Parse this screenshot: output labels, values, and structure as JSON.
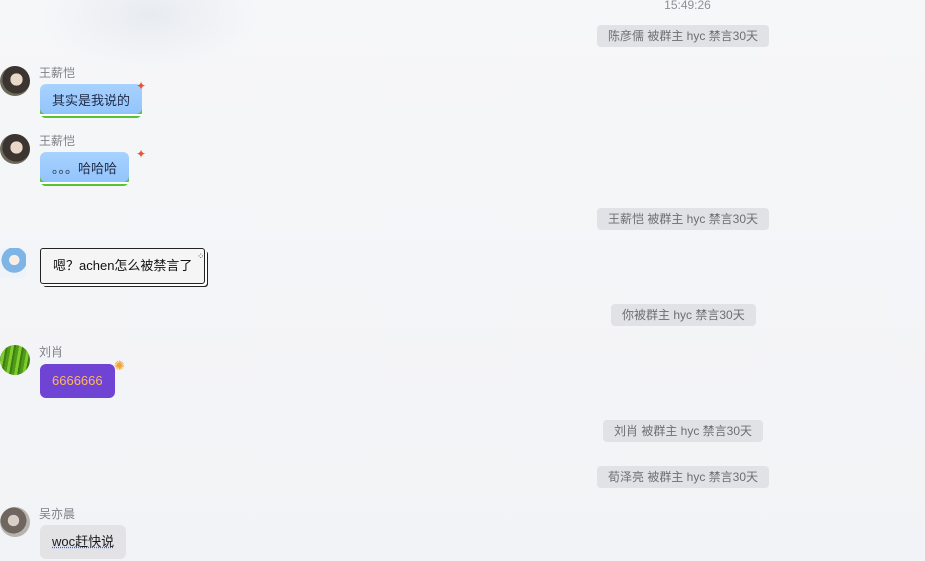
{
  "chat": {
    "timestamp": "15:49:26",
    "system_messages": [
      "陈彦儒 被群主 hyc 禁言30天",
      "王薪恺 被群主 hyc 禁言30天",
      "你被群主 hyc 禁言30天",
      "刘肖 被群主 hyc 禁言30天",
      "荀泽亮 被群主 hyc 禁言30天"
    ],
    "messages": [
      {
        "sender": "王薪恺",
        "text": "其实是我说的",
        "avatar": "avatar-wang"
      },
      {
        "sender": "王薪恺",
        "text": "。。。哈哈哈",
        "avatar": "avatar-wang"
      },
      {
        "sender": "",
        "text": "嗯？achen怎么被禁言了",
        "avatar": "avatar-cirno"
      },
      {
        "sender": "刘肖",
        "text": "6666666",
        "avatar": "avatar-bamboo"
      },
      {
        "sender": "吴亦晨",
        "text": "woc赶快说",
        "avatar": "avatar-wu"
      }
    ]
  },
  "colors": {
    "bubble_blue": "#a8d2ff",
    "bubble_purple": "#6f43d3",
    "bubble_purple_text": "#ffb85a",
    "system_bg": "#e1e2e6"
  }
}
